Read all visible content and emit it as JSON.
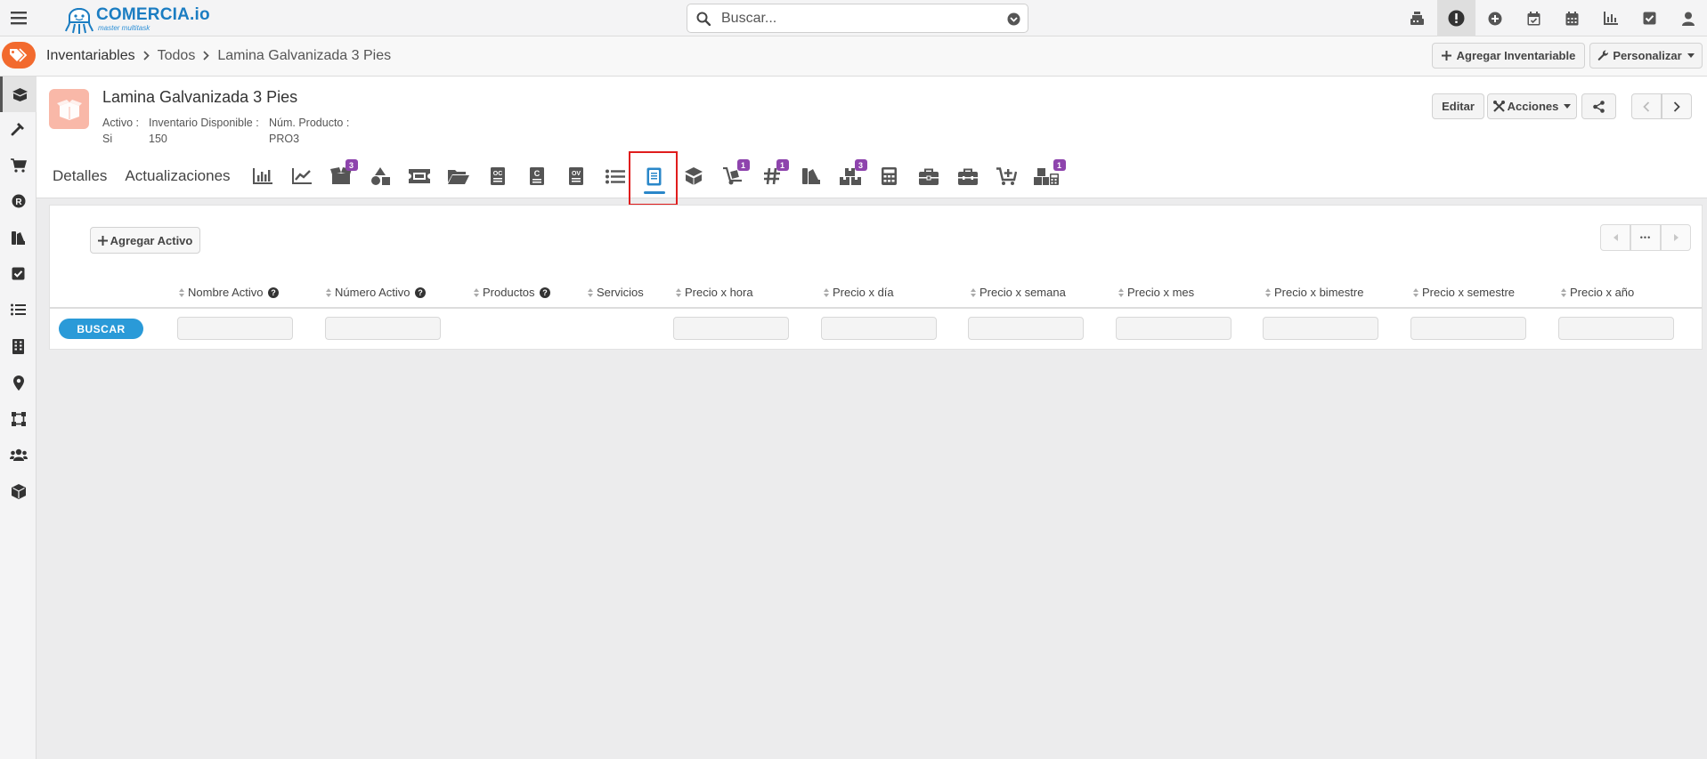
{
  "app": {
    "brand": "COMERCIA.io",
    "tagline": "master multitask"
  },
  "search": {
    "placeholder": "Buscar..."
  },
  "top_icons": [
    "cash-register-icon",
    "alert-icon",
    "plus-circle-icon",
    "calendar-check-icon",
    "calendar-icon",
    "chart-icon",
    "check-square-icon",
    "user-icon"
  ],
  "breadcrumb": {
    "items": [
      "Inventariables",
      "Todos",
      "Lamina Galvanizada 3 Pies"
    ]
  },
  "header_buttons": {
    "add_inventariable": "Agregar Inventariable",
    "personalizar": "Personalizar",
    "editar": "Editar",
    "acciones": "Acciones"
  },
  "product": {
    "title": "Lamina Galvanizada 3 Pies",
    "fields": [
      {
        "label": "Activo :",
        "value": "Si"
      },
      {
        "label": "Inventario Disponible :",
        "value": "150"
      },
      {
        "label": "Núm. Producto :",
        "value": "PRO3"
      }
    ]
  },
  "tabs": {
    "detalles": "Detalles",
    "actualizaciones": "Actualizaciones",
    "icon_tabs": [
      {
        "name": "bar-chart-icon",
        "badge": ""
      },
      {
        "name": "line-chart-icon",
        "badge": ""
      },
      {
        "name": "box-open-icon",
        "badge": "3"
      },
      {
        "name": "shapes-icon",
        "badge": ""
      },
      {
        "name": "ticket-icon",
        "badge": ""
      },
      {
        "name": "folder-open-icon",
        "badge": ""
      },
      {
        "name": "oc-document-icon",
        "badge": ""
      },
      {
        "name": "c-document-icon",
        "badge": ""
      },
      {
        "name": "ov-document-icon",
        "badge": ""
      },
      {
        "name": "list-icon",
        "badge": ""
      },
      {
        "name": "asset-file-icon",
        "badge": "",
        "selected": true
      },
      {
        "name": "box-stack-icon",
        "badge": ""
      },
      {
        "name": "dolly-icon",
        "badge": "1"
      },
      {
        "name": "hash-icon",
        "badge": "1"
      },
      {
        "name": "swatches-icon",
        "badge": ""
      },
      {
        "name": "boxes-icon",
        "badge": "3"
      },
      {
        "name": "calculator-icon",
        "badge": ""
      },
      {
        "name": "briefcase-icon",
        "badge": ""
      },
      {
        "name": "toolbox-icon",
        "badge": ""
      },
      {
        "name": "cart-plus-icon",
        "badge": ""
      },
      {
        "name": "boxes-calculator-icon",
        "badge": "1"
      }
    ]
  },
  "left_nav": [
    "inventory-box-icon",
    "hammer-icon",
    "cart-icon",
    "r-circle-icon",
    "swatches-icon",
    "check-square-icon",
    "list-icon",
    "building-icon",
    "map-pin-icon",
    "vector-square-icon",
    "users-icon",
    "cube-icon"
  ],
  "assets_table": {
    "add_label": "Agregar Activo",
    "pager_more": "•••",
    "columns": [
      {
        "label": "Nombre Activo",
        "help": true,
        "filter": true
      },
      {
        "label": "Número Activo",
        "help": true,
        "filter": true
      },
      {
        "label": "Productos",
        "help": true,
        "filter": false
      },
      {
        "label": "Servicios",
        "help": false,
        "filter": false
      },
      {
        "label": "Precio x hora",
        "help": false,
        "filter": true
      },
      {
        "label": "Precio x día",
        "help": false,
        "filter": true
      },
      {
        "label": "Precio x semana",
        "help": false,
        "filter": true
      },
      {
        "label": "Precio x mes",
        "help": false,
        "filter": true
      },
      {
        "label": "Precio x bimestre",
        "help": false,
        "filter": true
      },
      {
        "label": "Precio x semestre",
        "help": false,
        "filter": true
      },
      {
        "label": "Precio x año",
        "help": false,
        "filter": true
      }
    ],
    "search_button": "BUSCAR"
  },
  "colors": {
    "accent_blue": "#2a9ad8",
    "highlight_red": "#e01d1d",
    "badge_purple": "#8e44ad",
    "tag_orange": "#f26a2e"
  }
}
